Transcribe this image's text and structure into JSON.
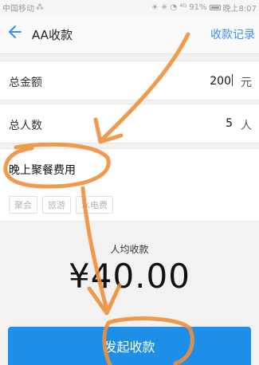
{
  "status_bar": {
    "carrier": "中国移动",
    "carrier_icon": "wechat-sync-icon",
    "indicators": "☀ ✳ ◔ ⁴ᴳ",
    "battery": "91%",
    "time": "晚上8:07"
  },
  "navbar": {
    "back_icon": "back-arrow-icon",
    "title": "AA收款",
    "right_link": "收款记录"
  },
  "form": {
    "total_amount": {
      "label": "总金额",
      "value": "200",
      "unit": "元"
    },
    "people_count": {
      "label": "总人数",
      "value": "5",
      "unit": "人"
    },
    "note": {
      "value": "晚上聚餐费用",
      "tags": [
        "聚会",
        "旅游",
        "水电费"
      ]
    }
  },
  "summary": {
    "per_person_label": "人均收款",
    "per_person_amount": "¥40.00"
  },
  "actions": {
    "submit_label": "发起收款"
  },
  "annotation": {
    "stroke_color": "#f0903a"
  }
}
